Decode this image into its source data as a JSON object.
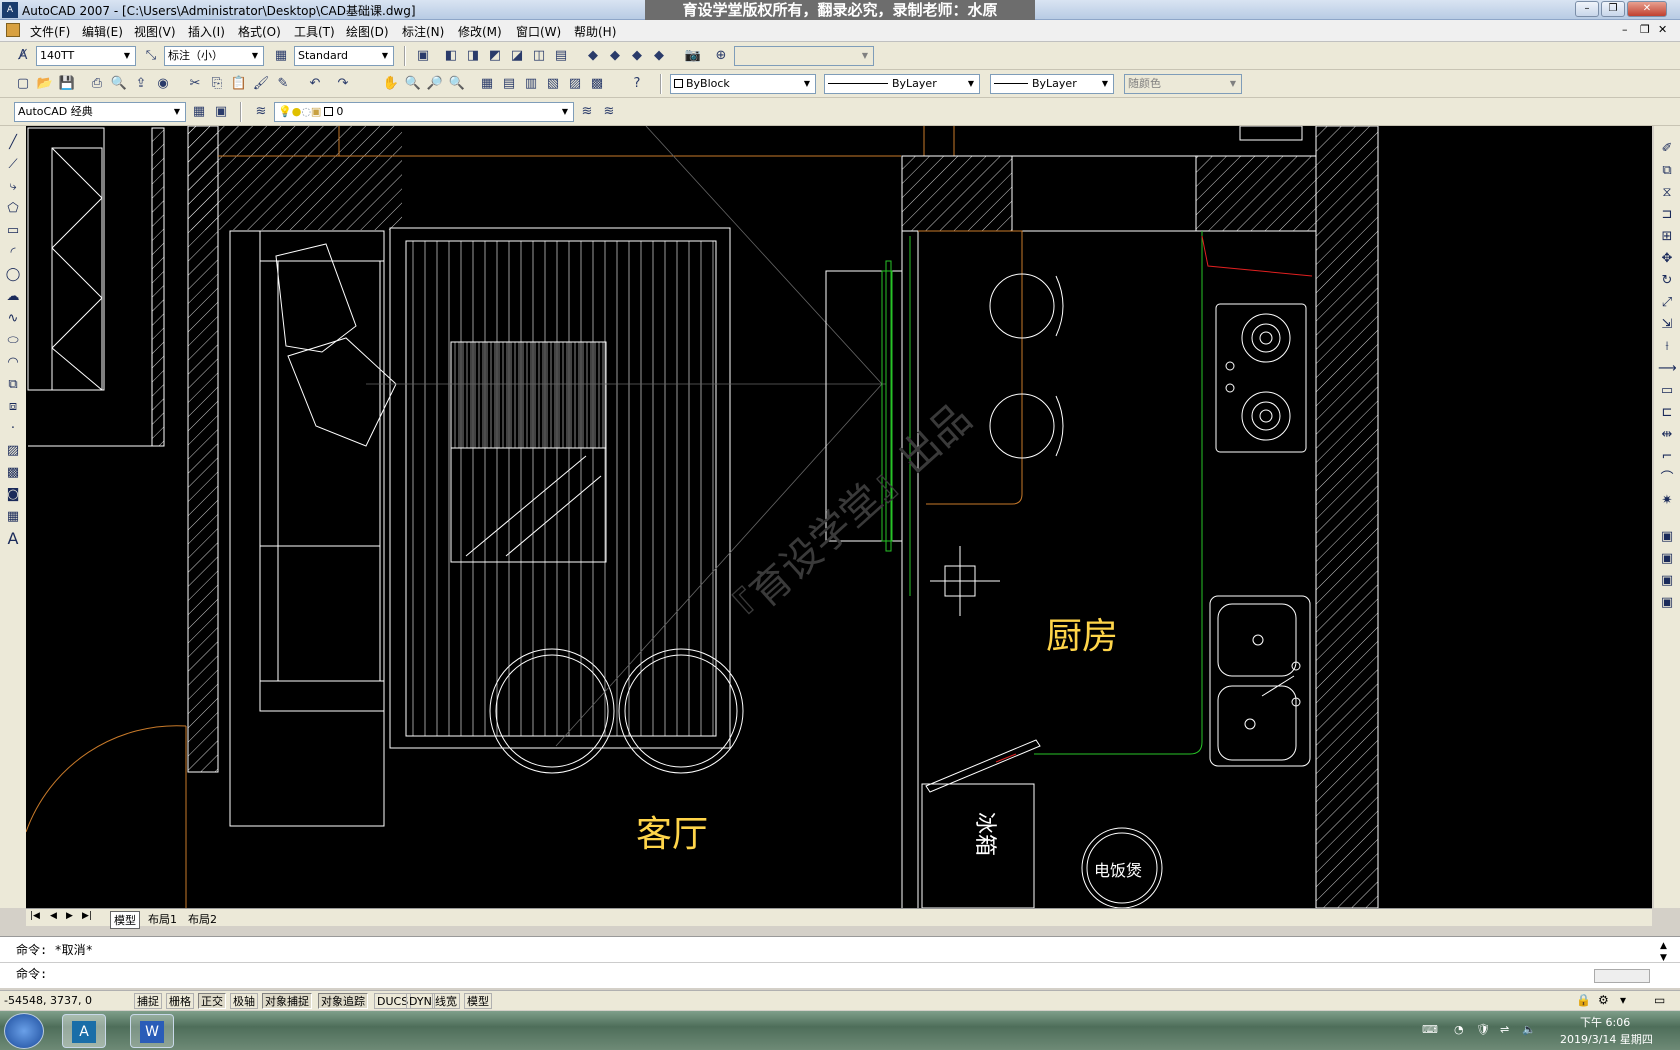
{
  "window": {
    "title": "AutoCAD 2007 - [C:\\Users\\Administrator\\Desktop\\CAD基础课.dwg]",
    "watermark": "育设学堂版权所有，翻录必究，录制老师：水原",
    "min": "–",
    "restore": "❐",
    "close": "✕"
  },
  "menu": [
    "文件(F)",
    "编辑(E)",
    "视图(V)",
    "插入(I)",
    "格式(O)",
    "工具(T)",
    "绘图(D)",
    "标注(N)",
    "修改(M)",
    "窗口(W)",
    "帮助(H)"
  ],
  "styles_toolbar": {
    "text_style": "140TT",
    "dim_style": "标注（小）",
    "table_style": "Standard",
    "view_combo": ""
  },
  "properties_toolbar": {
    "color": "ByBlock",
    "linetype": "ByLayer",
    "lineweight": "ByLayer",
    "plotstyle": "随颜色"
  },
  "workspace_toolbar": {
    "workspace": "AutoCAD 经典",
    "layer": "0"
  },
  "drawing": {
    "living_room_label": "客厅",
    "kitchen_label": "厨房",
    "fridge_label": "冰箱",
    "rice_cooker_label": "电饭煲",
    "watermark_text": "『育设学堂』出品",
    "colors": {
      "background": "#000000",
      "lines": "#ffffff",
      "labels": "#ffd54a",
      "orange": "#c87a2a",
      "green": "#27c427",
      "red": "#e02020"
    }
  },
  "layout_tabs": [
    "模型",
    "布局1",
    "布局2"
  ],
  "command_lines": [
    "命令: *取消*",
    "命令:"
  ],
  "status": {
    "coords": "-54548, 3737, 0",
    "buttons": [
      "捕捉",
      "栅格",
      "正交",
      "极轴",
      "对象捕捉",
      "对象追踪",
      "DUCS",
      "DYN",
      "线宽",
      "模型"
    ]
  },
  "taskbar": {
    "time": "下午 6:06",
    "date": "2019/3/14 星期四"
  }
}
